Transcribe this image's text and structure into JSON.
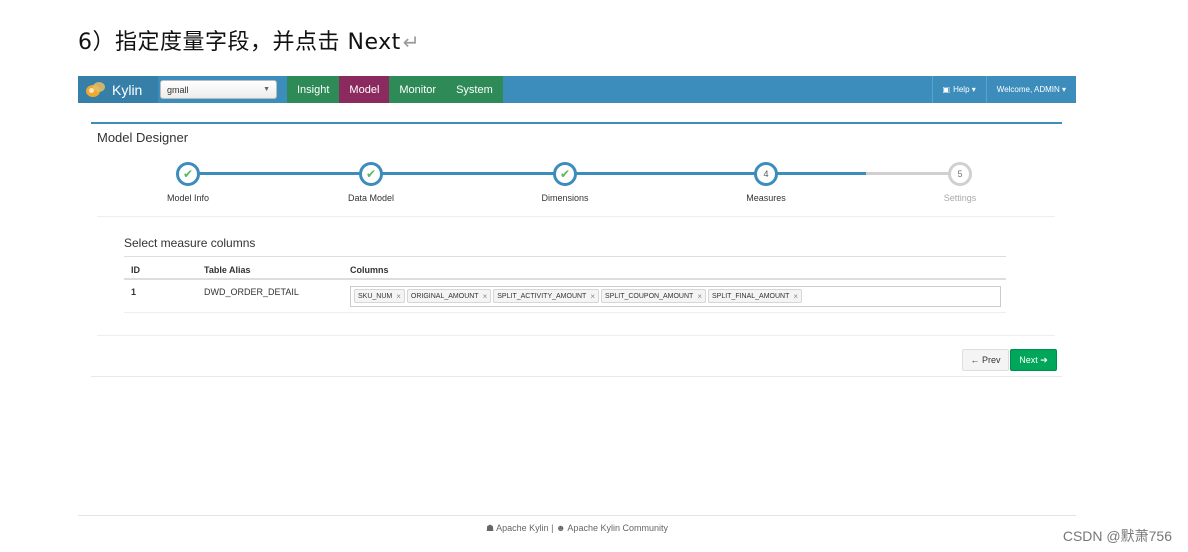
{
  "doc": {
    "heading": "6）指定度量字段，并点击 Next",
    "return_mark": "↵"
  },
  "navbar": {
    "brand": "Kylin",
    "project_select": {
      "value": "gmall",
      "caret": "▼"
    },
    "tabs": [
      {
        "label": "Insight",
        "active": false
      },
      {
        "label": "Model",
        "active": true
      },
      {
        "label": "Monitor",
        "active": false
      },
      {
        "label": "System",
        "active": false
      }
    ],
    "help_label": "Help ▾",
    "help_icon": "book-icon",
    "user_label": "Welcome, ADMIN ▾"
  },
  "panel": {
    "title": "Model Designer",
    "steps": [
      {
        "label": "Model Info",
        "state": "done",
        "mark": "✔"
      },
      {
        "label": "Data Model",
        "state": "done",
        "mark": "✔"
      },
      {
        "label": "Dimensions",
        "state": "done",
        "mark": "✔"
      },
      {
        "label": "Measures",
        "state": "current",
        "mark": "4"
      },
      {
        "label": "Settings",
        "state": "pending",
        "mark": "5"
      }
    ],
    "section_title": "Select measure columns",
    "table": {
      "headers": {
        "id": "ID",
        "alias": "Table Alias",
        "columns": "Columns"
      },
      "rows": [
        {
          "id": "1",
          "alias": "DWD_ORDER_DETAIL",
          "columns": [
            "SKU_NUM",
            "ORIGINAL_AMOUNT",
            "SPLIT_ACTIVITY_AMOUNT",
            "SPLIT_COUPON_AMOUNT",
            "SPLIT_FINAL_AMOUNT"
          ]
        }
      ]
    },
    "buttons": {
      "prev": "← Prev",
      "next": "Next ➔"
    }
  },
  "footer": {
    "text": "☗ Apache Kylin | ☻ Apache Kylin Community"
  },
  "watermark": "CSDN @默萧756",
  "colors": {
    "nav": "#3c8dbc",
    "nav_green": "#2e8b57",
    "nav_active": "#8b2a5e",
    "check": "#5bb75b",
    "next_button": "#00a65a"
  }
}
